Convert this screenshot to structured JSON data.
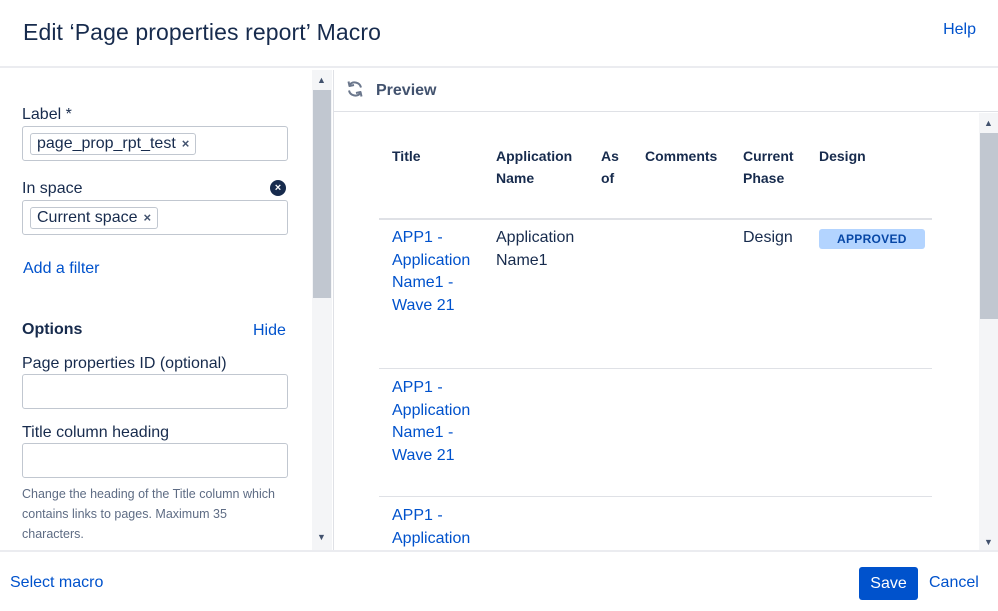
{
  "header": {
    "title": "Edit ‘Page properties report’ Macro",
    "help": "Help"
  },
  "form": {
    "label_field": {
      "label": "Label *",
      "chip": "page_prop_rpt_test",
      "chip_remove": "×"
    },
    "space_field": {
      "label": "In space",
      "chip": "Current space",
      "chip_remove": "×",
      "clear": "×"
    },
    "add_filter": "Add a filter",
    "options": {
      "title": "Options",
      "hide": "Hide"
    },
    "page_properties_id": {
      "label": "Page properties ID (optional)",
      "value": ""
    },
    "title_heading": {
      "label": "Title column heading",
      "value": ""
    },
    "help_text": "Change the heading of the Title column which contains links to pages. Maximum 35 characters."
  },
  "preview": {
    "label": "Preview",
    "columns": [
      "Title",
      "Application Name",
      "As of",
      "Comments",
      "Current Phase",
      "Design"
    ],
    "rows": [
      {
        "title": "APP1 - Application Name1 - Wave 21",
        "app_name": "Application Name1",
        "as_of": "",
        "comments": "",
        "phase": "Design",
        "design": "APPROVED"
      },
      {
        "title": "APP1 - Application Name1 - Wave 21",
        "app_name": "",
        "as_of": "",
        "comments": "",
        "phase": "",
        "design": ""
      },
      {
        "title": "APP1 - Application",
        "app_name": "",
        "as_of": "",
        "comments": "",
        "phase": "",
        "design": ""
      }
    ]
  },
  "footer": {
    "select_macro": "Select macro",
    "save": "Save",
    "cancel": "Cancel"
  },
  "colors": {
    "accent": "#0052cc",
    "lozenge_bg": "#b3d4ff",
    "lozenge_text": "#0747a6"
  }
}
